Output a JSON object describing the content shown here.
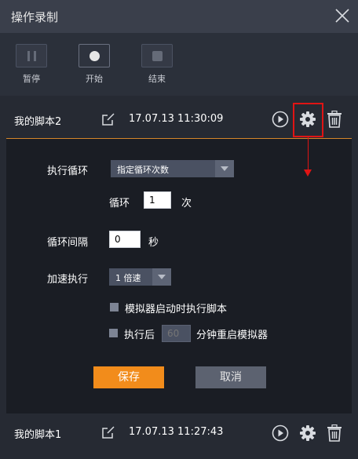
{
  "window": {
    "title": "操作录制"
  },
  "toolbar": {
    "pause_label": "暂停",
    "start_label": "开始",
    "stop_label": "结束"
  },
  "scripts": [
    {
      "name": "我的脚本2",
      "time": "17.07.13 11:30:09"
    },
    {
      "name": "我的脚本1",
      "time": "17.07.13 11:27:43"
    }
  ],
  "settings": {
    "loop_label": "执行循环",
    "loop_mode": "指定循环次数",
    "loop_count_label": "循环",
    "loop_count": "1",
    "loop_count_unit": "次",
    "interval_label": "循环间隔",
    "interval_value": "0",
    "interval_unit": "秒",
    "speed_label": "加速执行",
    "speed_value": "1 倍速",
    "run_on_start_label": "模拟器启动时执行脚本",
    "restart_prefix": "执行后",
    "restart_minutes_placeholder": "60",
    "restart_suffix": "分钟重启模拟器",
    "save_label": "保存",
    "cancel_label": "取消"
  },
  "colors": {
    "accent": "#f28c1b",
    "highlight": "#e01414",
    "panel_bg": "#1a1d24"
  }
}
